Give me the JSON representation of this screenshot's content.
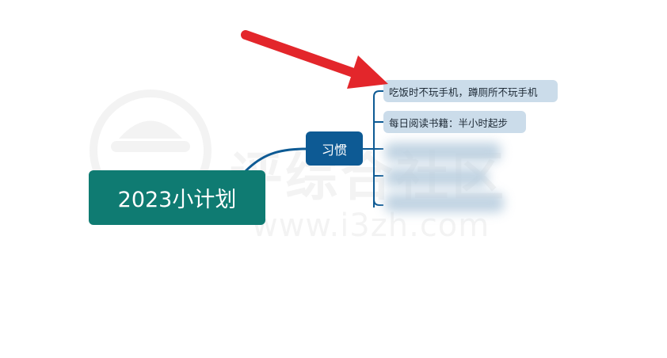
{
  "mindmap": {
    "root": {
      "label": "2023小计划"
    },
    "branches": [
      {
        "label": "习惯",
        "children": [
          {
            "label": "吃饭时不玩手机，蹲厕所不玩手机"
          },
          {
            "label": "每日阅读书籍：半小时起步"
          }
        ]
      }
    ]
  },
  "watermark": {
    "name": "评综合社区",
    "url": "www.i3zh.com"
  },
  "colors": {
    "root_fill": "#0f7b72",
    "branch_fill": "#0d5a94",
    "subtopic_fill": "#cbdcea",
    "connector": "#0d5a94",
    "annotation_arrow": "#e3262b"
  }
}
